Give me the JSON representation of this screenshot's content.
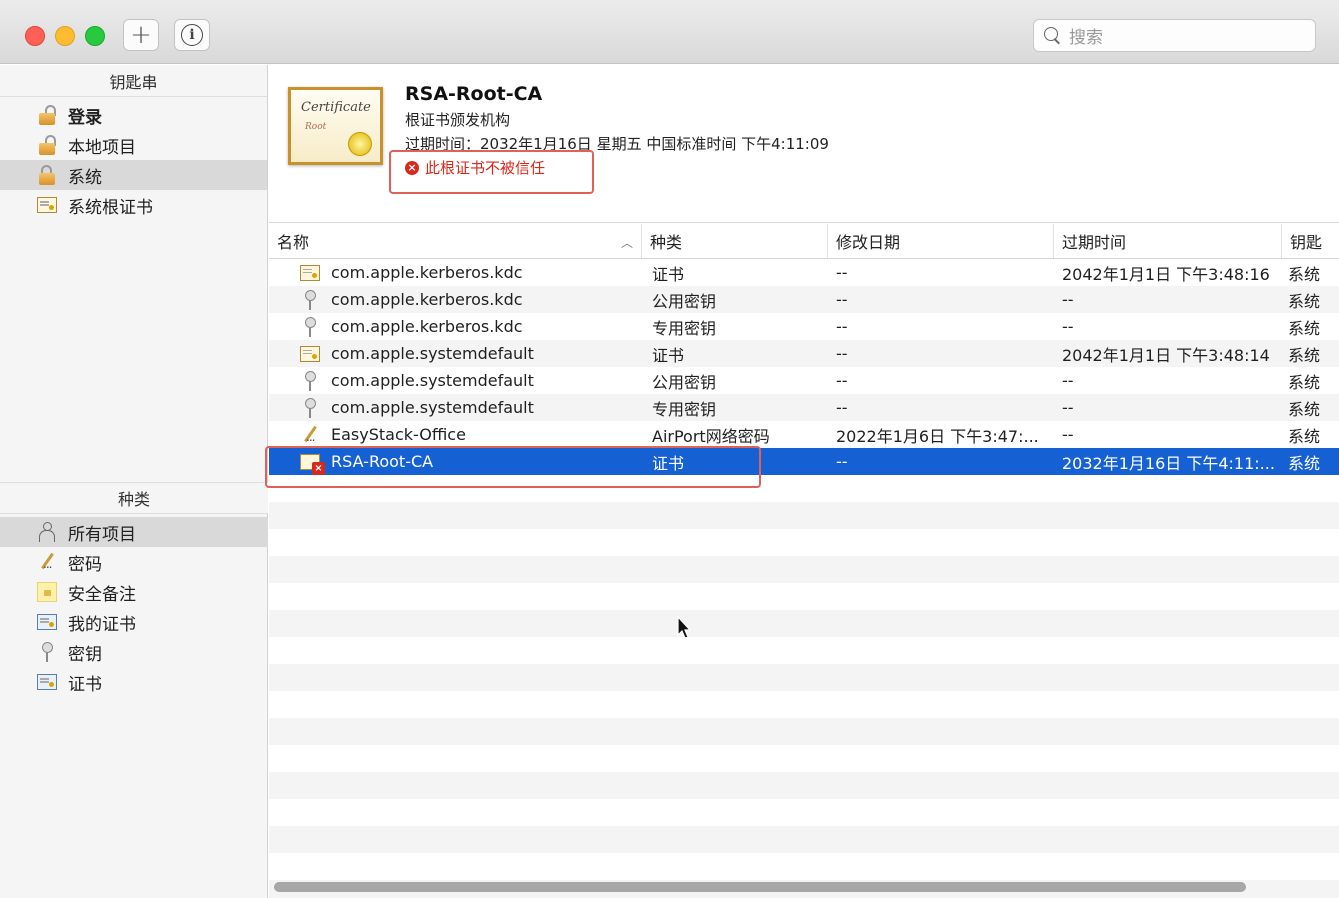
{
  "toolbar": {
    "add_label": "+",
    "info_label": "i",
    "search_placeholder": "搜索"
  },
  "sidebar": {
    "keychains_header": "钥匙串",
    "keychains": [
      {
        "label": "登录",
        "icon": "unlocked-lock-icon"
      },
      {
        "label": "本地项目",
        "icon": "unlocked-lock-icon"
      },
      {
        "label": "系统",
        "icon": "locked-lock-icon"
      },
      {
        "label": "系统根证书",
        "icon": "certificate-icon"
      }
    ],
    "categories_header": "种类",
    "categories": [
      {
        "label": "所有项目",
        "icon": "people-icon"
      },
      {
        "label": "密码",
        "icon": "password-icon"
      },
      {
        "label": "安全备注",
        "icon": "secure-note-icon"
      },
      {
        "label": "我的证书",
        "icon": "my-certificate-icon"
      },
      {
        "label": "密钥",
        "icon": "key-icon"
      },
      {
        "label": "证书",
        "icon": "certificate-icon"
      }
    ]
  },
  "detail": {
    "cert_word": "Certificate",
    "cert_sub": "Root",
    "title": "RSA-Root-CA",
    "subtitle": "根证书颁发机构",
    "expires": "过期时间：2032年1月16日 星期五 中国标准时间 下午4:11:09",
    "warning": "此根证书不被信任"
  },
  "table": {
    "columns": [
      "名称",
      "种类",
      "修改日期",
      "过期时间",
      "钥匙"
    ],
    "sort_indicator": "^",
    "rows": [
      {
        "name": "com.apple.kerberos.kdc",
        "kind": "证书",
        "modified": "--",
        "expires": "2042年1月1日 下午3:48:16",
        "keychain": "系统",
        "icon": "certificate-icon"
      },
      {
        "name": "com.apple.kerberos.kdc",
        "kind": "公用密钥",
        "modified": "--",
        "expires": "--",
        "keychain": "系统",
        "icon": "key-icon"
      },
      {
        "name": "com.apple.kerberos.kdc",
        "kind": "专用密钥",
        "modified": "--",
        "expires": "--",
        "keychain": "系统",
        "icon": "key-icon"
      },
      {
        "name": "com.apple.systemdefault",
        "kind": "证书",
        "modified": "--",
        "expires": "2042年1月1日 下午3:48:14",
        "keychain": "系统",
        "icon": "certificate-icon"
      },
      {
        "name": "com.apple.systemdefault",
        "kind": "公用密钥",
        "modified": "--",
        "expires": "--",
        "keychain": "系统",
        "icon": "key-icon"
      },
      {
        "name": "com.apple.systemdefault",
        "kind": "专用密钥",
        "modified": "--",
        "expires": "--",
        "keychain": "系统",
        "icon": "key-icon"
      },
      {
        "name": "EasyStack-Office",
        "kind": "AirPort网络密码",
        "modified": "2022年1月6日 下午3:47:...",
        "expires": "--",
        "keychain": "系统",
        "icon": "password-icon"
      },
      {
        "name": "RSA-Root-CA",
        "kind": "证书",
        "modified": "--",
        "expires": "2032年1月16日 下午4:11:...",
        "keychain": "系统",
        "icon": "untrusted-certificate-icon",
        "selected": true
      }
    ]
  }
}
